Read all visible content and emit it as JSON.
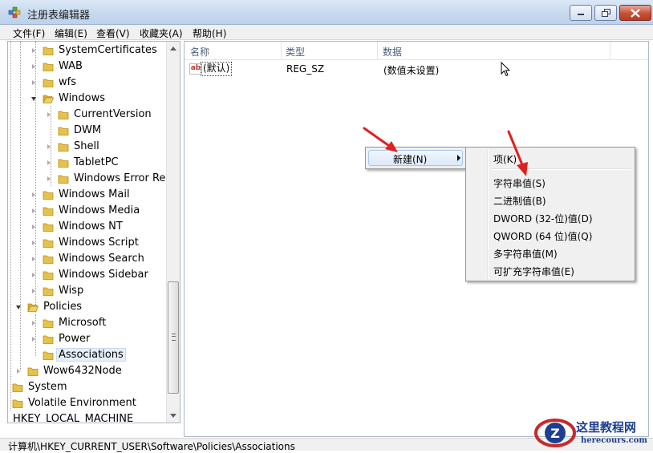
{
  "window": {
    "title": "注册表编辑器"
  },
  "menu": [
    "文件(F)",
    "编辑(E)",
    "查看(V)",
    "收藏夹(A)",
    "帮助(H)"
  ],
  "tree": {
    "items": [
      {
        "label": "SystemCertificates"
      },
      {
        "label": "WAB"
      },
      {
        "label": "wfs"
      },
      {
        "label": "Windows"
      },
      {
        "label": "CurrentVersion"
      },
      {
        "label": "DWM"
      },
      {
        "label": "Shell"
      },
      {
        "label": "TabletPC"
      },
      {
        "label": "Windows Error Rep"
      },
      {
        "label": "Windows Mail"
      },
      {
        "label": "Windows Media"
      },
      {
        "label": "Windows NT"
      },
      {
        "label": "Windows Script"
      },
      {
        "label": "Windows Search"
      },
      {
        "label": "Windows Sidebar"
      },
      {
        "label": "Wisp"
      },
      {
        "label": "Policies"
      },
      {
        "label": "Microsoft"
      },
      {
        "label": "Power"
      },
      {
        "label": "Associations"
      },
      {
        "label": "Wow6432Node"
      },
      {
        "label": "System"
      },
      {
        "label": "Volatile Environment"
      },
      {
        "label": "HKEY_LOCAL_MACHINE"
      }
    ]
  },
  "values": {
    "columns": [
      "名称",
      "类型",
      "数据"
    ],
    "rows": [
      {
        "name": "(默认)",
        "type": "REG_SZ",
        "data": "(数值未设置)",
        "icon": "ab"
      }
    ]
  },
  "context_menu": {
    "main_item": "新建(N)",
    "sub_items": [
      "项(K)",
      "字符串值(S)",
      "二进制值(B)",
      "DWORD (32-位)值(D)",
      "QWORD (64 位)值(Q)",
      "多字符串值(M)",
      "可扩充字符串值(E)"
    ]
  },
  "status": {
    "path": "计算机\\HKEY_CURRENT_USER\\Software\\Policies\\Associations"
  },
  "watermark": {
    "title": "这里教程网",
    "url": "herecours.com",
    "logo_letter": "Z"
  },
  "colors": {
    "folder": "#e8c14a",
    "arrow": "#e02020",
    "header_text": "#4c607a"
  }
}
